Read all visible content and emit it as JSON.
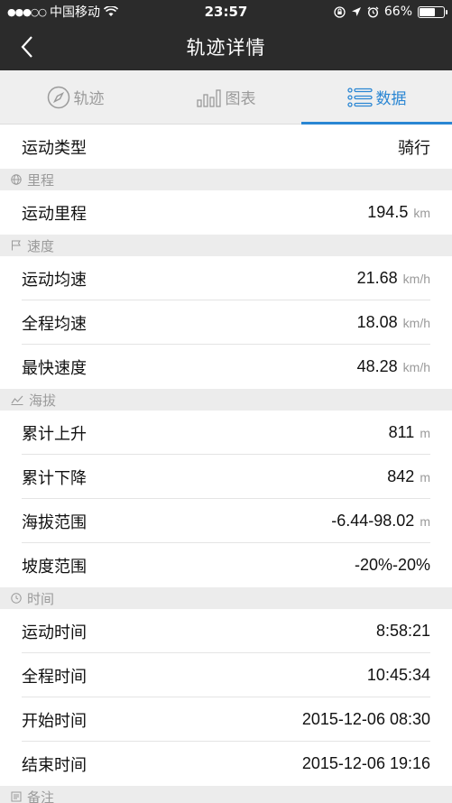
{
  "status": {
    "carrier": "中国移动",
    "time": "23:57",
    "battery": "66%",
    "battery_level": 0.66
  },
  "nav": {
    "title": "轨迹详情"
  },
  "tabs": [
    {
      "label": "轨迹",
      "icon": "compass-icon"
    },
    {
      "label": "图表",
      "icon": "bar-chart-icon"
    },
    {
      "label": "数据",
      "icon": "list-icon"
    }
  ],
  "top": {
    "label": "运动类型",
    "value": "骑行"
  },
  "sections": {
    "distance": {
      "title": "里程",
      "icon": "globe-icon",
      "rows": [
        {
          "label": "运动里程",
          "value": "194.5",
          "unit": "km"
        }
      ]
    },
    "speed": {
      "title": "速度",
      "icon": "flag-icon",
      "rows": [
        {
          "label": "运动均速",
          "value": "21.68",
          "unit": "km/h"
        },
        {
          "label": "全程均速",
          "value": "18.08",
          "unit": "km/h"
        },
        {
          "label": "最快速度",
          "value": "48.28",
          "unit": "km/h"
        }
      ]
    },
    "altitude": {
      "title": "海拔",
      "icon": "trend-icon",
      "rows": [
        {
          "label": "累计上升",
          "value": "811",
          "unit": "m"
        },
        {
          "label": "累计下降",
          "value": "842",
          "unit": "m"
        },
        {
          "label": "海拔范围",
          "value": "-6.44-98.02",
          "unit": "m"
        },
        {
          "label": "坡度范围",
          "value": "-20%-20%",
          "unit": ""
        }
      ]
    },
    "time": {
      "title": "时间",
      "icon": "clock-icon",
      "rows": [
        {
          "label": "运动时间",
          "value": "8:58:21",
          "unit": ""
        },
        {
          "label": "全程时间",
          "value": "10:45:34",
          "unit": ""
        },
        {
          "label": "开始时间",
          "value": "2015-12-06 08:30",
          "unit": ""
        },
        {
          "label": "结束时间",
          "value": "2015-12-06 19:16",
          "unit": ""
        }
      ]
    },
    "notes": {
      "title": "备注",
      "icon": "note-icon"
    }
  }
}
